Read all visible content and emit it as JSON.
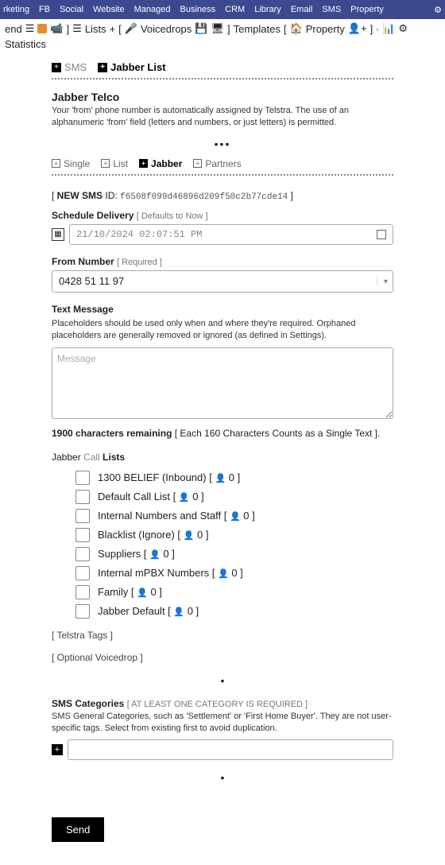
{
  "topnav": [
    "rketing",
    "FB",
    "Social",
    "Website",
    "Managed",
    "Business",
    "CRM",
    "Library",
    "Email",
    "SMS",
    "Property"
  ],
  "toolbar": {
    "end": "end",
    "lists": "Lists",
    "voicedrops": "Voicedrops",
    "templates": "Templates",
    "property": "Property",
    "statistics": "Statistics"
  },
  "maintabs": {
    "sms": "SMS",
    "jabber": "Jabber List"
  },
  "telco": {
    "title": "Jabber Telco",
    "desc": "Your 'from' phone number is automatically assigned by Telstra. The use of an alphanumeric 'from' field (letters and numbers, or just letters) is permitted."
  },
  "subtabs": {
    "single": "Single",
    "list": "List",
    "jabber": "Jabber",
    "partners": "Partners"
  },
  "newsms": {
    "label": "NEW SMS",
    "idlabel": "ID:",
    "id": "f6508f099d46896d209f50c2b77cde14"
  },
  "schedule": {
    "label": "Schedule Delivery",
    "hint": "[ Defaults to Now ]",
    "value": "21/10/2024  02:07:51  PM"
  },
  "from": {
    "label": "From Number",
    "hint": "[ Required ]",
    "value": "0428 51 11 97"
  },
  "message": {
    "label": "Text Message",
    "help": "Placeholders should be used only when and where they're required. Orphaned placeholders are generally removed or ignored (as defined in Settings).",
    "placeholder": "Message",
    "remaining_bold": "1900 characters remaining",
    "remaining_rest": " [ Each 160 Characters Counts as a Single Text ]."
  },
  "calllists": {
    "title_pre": "Jabber ",
    "title_mid": "Call",
    "title_post": " Lists",
    "items": [
      {
        "name": "1300 BELIEF (Inbound)",
        "count": "0"
      },
      {
        "name": "Default Call List",
        "count": "0"
      },
      {
        "name": "Internal Numbers and Staff",
        "count": "0"
      },
      {
        "name": "Blacklist (Ignore)",
        "count": "0"
      },
      {
        "name": "Suppliers",
        "count": "0"
      },
      {
        "name": "Internal mPBX Numbers",
        "count": "0"
      },
      {
        "name": "Family",
        "count": "0"
      },
      {
        "name": "Jabber Default",
        "count": "0"
      }
    ]
  },
  "telstra_tags": "[ Telstra Tags ]",
  "voicedrop": "[ Optional Voicedrop ]",
  "categories": {
    "label": "SMS Categories",
    "req": "[ AT LEAST ONE CATEGORY IS REQUIRED ]",
    "help": "SMS General Categories, such as 'Settlement' or 'First Home Buyer'. They are not user-specific tags. Select from existing first to avoid duplication."
  },
  "send": "Send"
}
